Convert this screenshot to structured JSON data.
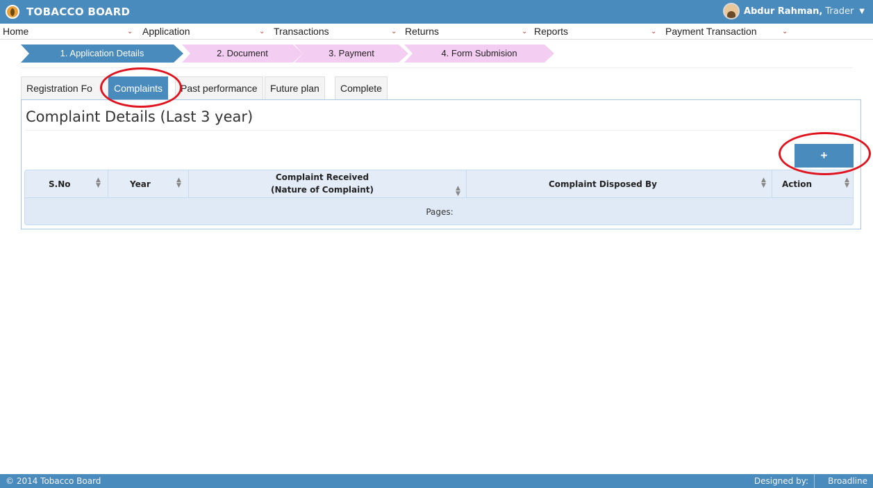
{
  "header": {
    "title": "TOBACCO BOARD",
    "user_name": "Abdur Rahman,",
    "user_role": "Trader",
    "logo_icon": "leaf-logo-icon",
    "caret_icon": "caret-down-icon"
  },
  "menu": [
    {
      "label": "Home"
    },
    {
      "label": "Application"
    },
    {
      "label": "Transactions"
    },
    {
      "label": "Returns"
    },
    {
      "label": "Reports"
    },
    {
      "label": "Payment Transaction"
    }
  ],
  "steps": [
    {
      "label": "1. Application Details",
      "active": true
    },
    {
      "label": "2. Document",
      "active": false
    },
    {
      "label": "3. Payment",
      "active": false
    },
    {
      "label": "4. Form Submision",
      "active": false
    }
  ],
  "tabs": [
    {
      "label": "Registration Fo",
      "active": false
    },
    {
      "label": "Complaints",
      "active": true
    },
    {
      "label": "Past performance",
      "active": false
    },
    {
      "label": "Future plan",
      "active": false
    },
    {
      "label": "Complete",
      "active": false
    }
  ],
  "panel": {
    "title": "Complaint Details (Last 3 year)",
    "add_button": "+"
  },
  "table": {
    "columns": [
      {
        "line1": "S.No",
        "line2": ""
      },
      {
        "line1": "Year",
        "line2": ""
      },
      {
        "line1": "Complaint Received",
        "line2": "(Nature of Complaint)"
      },
      {
        "line1": "Complaint Disposed By",
        "line2": ""
      },
      {
        "line1": "Action",
        "line2": ""
      }
    ],
    "pager_label": "Pages:"
  },
  "footer": {
    "copyright": "© 2014 Tobacco Board",
    "designed_by": "Designed by:",
    "vendor": "Broadline"
  },
  "colors": {
    "primary": "#4a8bbd",
    "step_inactive": "#f4cdf2",
    "annotation": "#e0141e"
  }
}
